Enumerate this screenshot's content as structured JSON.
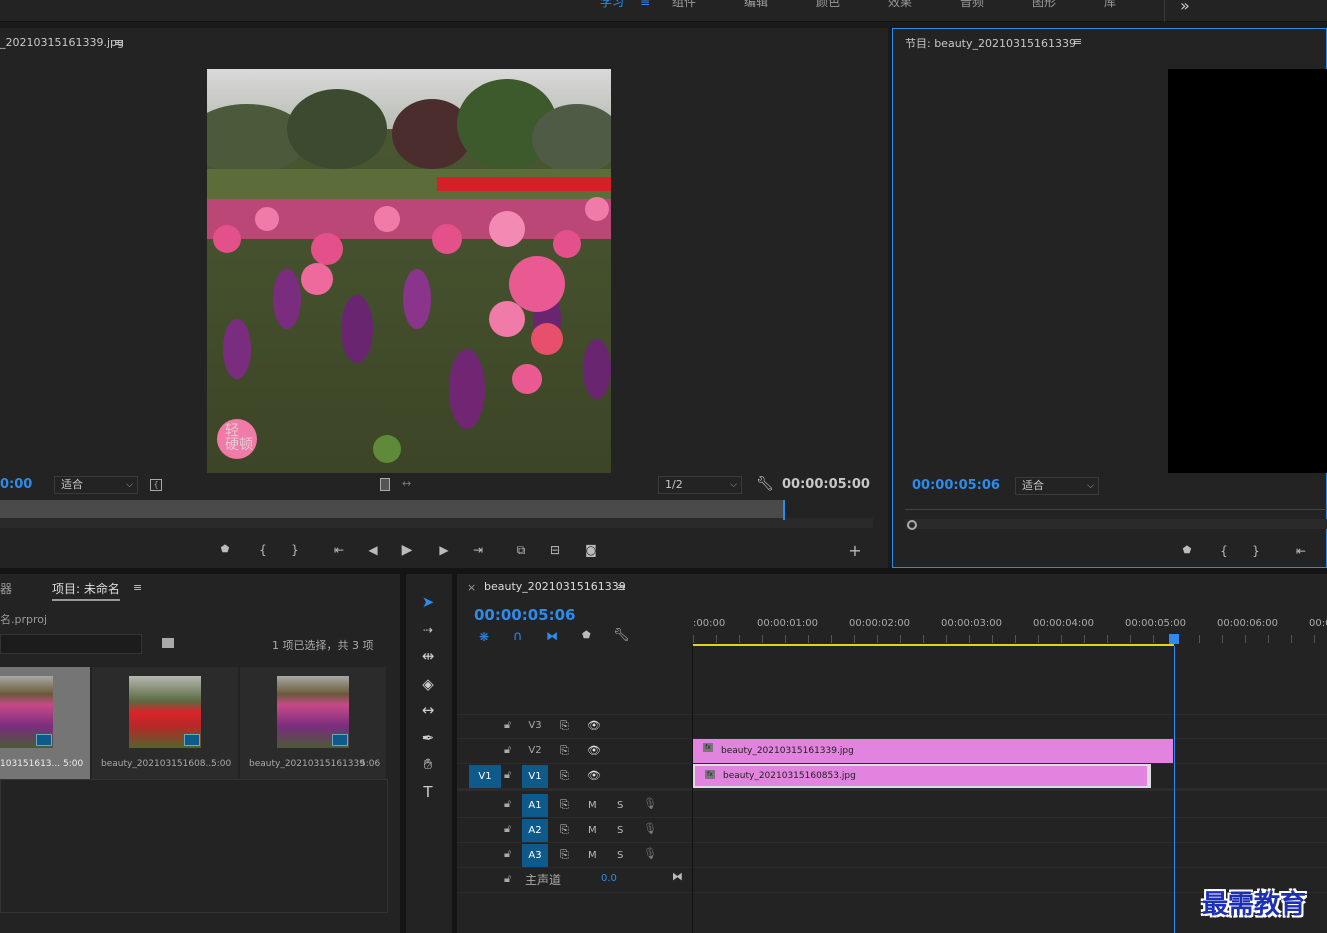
{
  "workspaces": {
    "tabs": [
      {
        "label": "学习",
        "active": true
      },
      {
        "label": "组件"
      },
      {
        "label": "编辑"
      },
      {
        "label": "颜色"
      },
      {
        "label": "效果"
      },
      {
        "label": "音频"
      },
      {
        "label": "图形"
      },
      {
        "label": "库"
      }
    ],
    "more_icon": "»",
    "menu_icon": "≡"
  },
  "source_monitor": {
    "title": "_20210315161339.jpg",
    "menu_icon": "≡",
    "timecode_left": "0:00",
    "fit_label": "适合",
    "resolution_label": "1/2",
    "timecode_right": "00:00:05:00",
    "overlay_text": "轻\n硬顿"
  },
  "program_monitor": {
    "title": "节目: beauty_20210315161339",
    "menu_icon": "≡",
    "timecode": "00:00:05:06",
    "fit_label": "适合"
  },
  "project": {
    "tab_left": "器",
    "tab_active": "项目: 未命名",
    "menu_icon": "≡",
    "file": "名.prproj",
    "selection_info": "1 项已选择，共 3 项",
    "items": [
      {
        "name": "103151613...",
        "duration": "5:00"
      },
      {
        "name": "beauty_202103151608...",
        "duration": "5:00"
      },
      {
        "name": "beauty_20210315161339",
        "duration": "5:06"
      }
    ]
  },
  "timeline": {
    "close_icon": "×",
    "sequence_name": "beauty_20210315161339",
    "menu_icon": "≡",
    "timecode": "00:00:05:06",
    "ruler_labels": [
      ":00:00",
      "00:00:01:00",
      "00:00:02:00",
      "00:00:03:00",
      "00:00:04:00",
      "00:00:05:00",
      "00:00:06:00",
      "00:0"
    ],
    "video_tracks": [
      "V3",
      "V2",
      "V1"
    ],
    "audio_tracks": [
      "A1",
      "A2",
      "A3"
    ],
    "source_patch": "V1",
    "mute_label": "M",
    "solo_label": "S",
    "master_label": "主声道",
    "master_value": "0.0",
    "clips": [
      {
        "track": "V2",
        "name": "beauty_20210315161339.jpg"
      },
      {
        "track": "V1",
        "name": "beauty_20210315160853.jpg"
      }
    ],
    "fx_label": "fx"
  },
  "tools": [
    "selection-tool",
    "track-select-tool",
    "ripple-edit-tool",
    "razor-tool",
    "slip-tool",
    "pen-tool",
    "hand-tool",
    "type-tool"
  ],
  "watermark": "最需教育",
  "colors": {
    "accent": "#2d8ceb",
    "clip": "#e383e0",
    "track_on": "#0e5a8a",
    "playhead": "#2d8ceb",
    "work_area": "#e6d21a"
  }
}
